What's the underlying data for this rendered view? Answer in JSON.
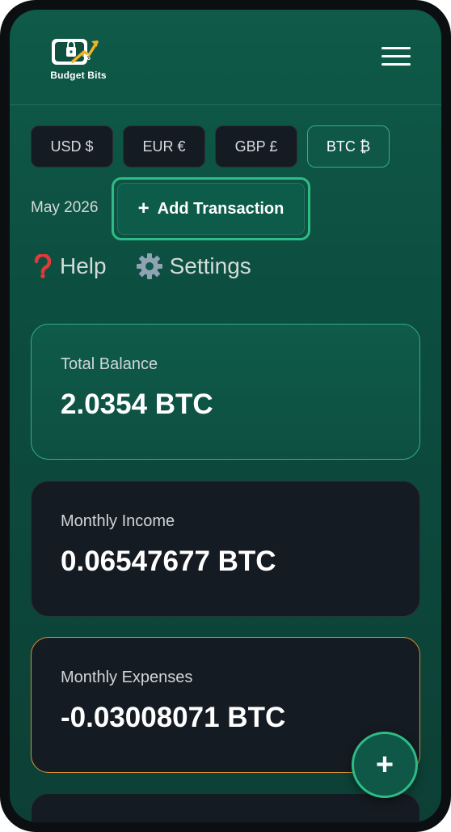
{
  "app": {
    "name": "Budget Bits",
    "menu_icon": "hamburger-menu-icon"
  },
  "currencies": [
    {
      "label": "USD $",
      "active": false
    },
    {
      "label": "EUR €",
      "active": false
    },
    {
      "label": "GBP £",
      "active": false
    },
    {
      "label": "BTC ₿",
      "active": true
    }
  ],
  "toolbar": {
    "month": "May 2026",
    "add_plus": "+",
    "add_label": "Add Transaction"
  },
  "links": {
    "help": {
      "icon": "question-mark-icon",
      "label": "Help"
    },
    "settings": {
      "icon": "gear-icon",
      "label": "Settings"
    }
  },
  "cards": {
    "total_balance": {
      "label": "Total Balance",
      "value": "2.0354 BTC"
    },
    "monthly_income": {
      "label": "Monthly Income",
      "value": "0.06547677 BTC"
    },
    "monthly_expenses": {
      "label": "Monthly Expenses",
      "value": "-0.03008071 BTC"
    }
  },
  "fab": {
    "label": "+"
  },
  "colors": {
    "accent": "#2fb382",
    "expense_border": "#d99134",
    "background": "#0f5a48",
    "card_dark": "#151b22"
  }
}
